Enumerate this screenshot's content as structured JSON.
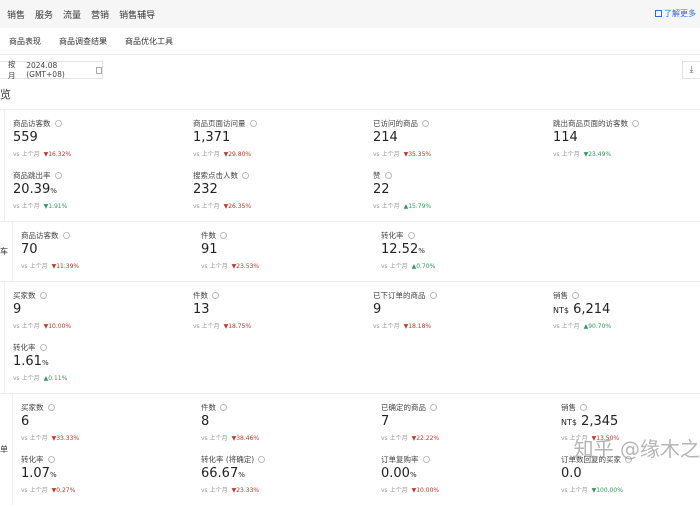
{
  "topnav": {
    "items": [
      "销售",
      "服务",
      "流量",
      "营销",
      "销售辅导"
    ],
    "learn_more": "了解更多"
  },
  "subtabs": [
    "商品表现",
    "商品调查结果",
    "商品优化工具"
  ],
  "date": {
    "mode": "按月",
    "value": "2024.08 (GMT+08)"
  },
  "heading": "览",
  "compare_label": "vs 上个月",
  "colors": {
    "red": "#c0392b",
    "green": "#2e9b5a"
  },
  "sections": [
    {
      "label": "",
      "cards": [
        {
          "label": "商品访客数",
          "value": "559",
          "unit": "",
          "change": "16.32%",
          "dir": "down",
          "color": "red"
        },
        {
          "label": "商品页面访问量",
          "value": "1,371",
          "unit": "",
          "change": "29.80%",
          "dir": "down",
          "color": "red"
        },
        {
          "label": "已访问的商品",
          "value": "214",
          "unit": "",
          "change": "35.35%",
          "dir": "down",
          "color": "red"
        },
        {
          "label": "跳出商品页面的访客数",
          "value": "114",
          "unit": "",
          "change": "23.49%",
          "dir": "down",
          "color": "green"
        },
        {
          "label": "商品跳出率",
          "value": "20.39",
          "unit": "%",
          "change": "1.91%",
          "dir": "down",
          "color": "green"
        },
        {
          "label": "搜索点击人数",
          "value": "232",
          "unit": "",
          "change": "26.35%",
          "dir": "down",
          "color": "red"
        },
        {
          "label": "赞",
          "value": "22",
          "unit": "",
          "change": "15.79%",
          "dir": "up",
          "color": "green"
        }
      ]
    },
    {
      "label": "车",
      "cards": [
        {
          "label": "商品访客数",
          "value": "70",
          "unit": "",
          "change": "11.39%",
          "dir": "down",
          "color": "red"
        },
        {
          "label": "件数",
          "value": "91",
          "unit": "",
          "change": "23.53%",
          "dir": "down",
          "color": "red"
        },
        {
          "label": "转化率",
          "value": "12.52",
          "unit": "%",
          "change": "0.70%",
          "dir": "up",
          "color": "green"
        }
      ]
    },
    {
      "label": "",
      "cards": [
        {
          "label": "买家数",
          "value": "9",
          "unit": "",
          "change": "10.00%",
          "dir": "down",
          "color": "red"
        },
        {
          "label": "件数",
          "value": "13",
          "unit": "",
          "change": "18.75%",
          "dir": "down",
          "color": "red"
        },
        {
          "label": "已下订单的商品",
          "value": "9",
          "unit": "",
          "change": "18.18%",
          "dir": "down",
          "color": "red"
        },
        {
          "label": "销售",
          "currency": "NT$",
          "value": "6,214",
          "unit": "",
          "change": "90.70%",
          "dir": "up",
          "color": "green"
        },
        {
          "label": "转化率",
          "value": "1.61",
          "unit": "%",
          "change": "0.11%",
          "dir": "up",
          "color": "green"
        }
      ]
    },
    {
      "label": "单",
      "cards": [
        {
          "label": "买家数",
          "value": "6",
          "unit": "",
          "change": "33.33%",
          "dir": "down",
          "color": "red"
        },
        {
          "label": "件数",
          "value": "8",
          "unit": "",
          "change": "38.46%",
          "dir": "down",
          "color": "red"
        },
        {
          "label": "已确定的商品",
          "value": "7",
          "unit": "",
          "change": "22.22%",
          "dir": "down",
          "color": "red"
        },
        {
          "label": "销售",
          "currency": "NT$",
          "value": "2,345",
          "unit": "",
          "change": "13.50%",
          "dir": "down",
          "color": "red"
        },
        {
          "label": "转化率",
          "value": "1.07",
          "unit": "%",
          "change": "0.27%",
          "dir": "down",
          "color": "red"
        },
        {
          "label": "转化率 (将确定)",
          "value": "66.67",
          "unit": "%",
          "change": "23.33%",
          "dir": "down",
          "color": "red"
        },
        {
          "label": "订单复购率",
          "value": "0.00",
          "unit": "%",
          "change": "10.00%",
          "dir": "down",
          "color": "red"
        },
        {
          "label": "订单数回复的买家",
          "value": "0.0",
          "unit": "",
          "change": "100.00%",
          "dir": "down",
          "color": "green"
        }
      ]
    }
  ],
  "watermark": "知乎 @缘木之"
}
